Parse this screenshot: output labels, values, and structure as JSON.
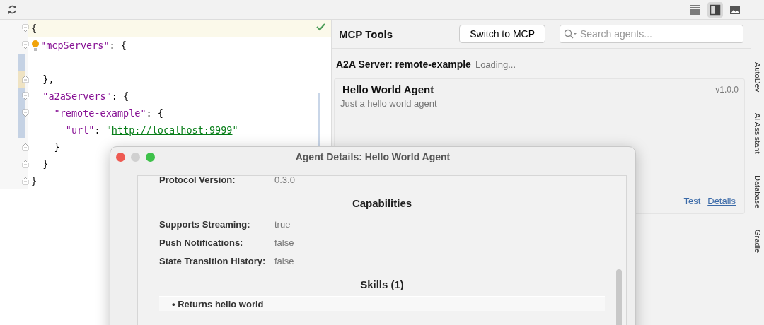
{
  "toolbar": {
    "view_buttons": [
      {
        "kind": "list",
        "selected": false
      },
      {
        "kind": "panel",
        "selected": true
      },
      {
        "kind": "image",
        "selected": false
      }
    ]
  },
  "editor": {
    "lines": [
      {
        "kind": "code",
        "current": true,
        "fold_start": true,
        "fold_end": false,
        "hint": false,
        "changed": false,
        "added": false,
        "tokens": [
          {
            "kind": "punct",
            "text": "{"
          }
        ]
      },
      {
        "kind": "code",
        "current": false,
        "fold_start": true,
        "fold_end": false,
        "hint": true,
        "changed": false,
        "added": false,
        "tokens": [
          {
            "kind": "key",
            "text": "\"mcpServers\""
          },
          {
            "kind": "punct",
            "text": ": {"
          }
        ]
      },
      {
        "kind": "blank",
        "current": false,
        "fold_start": false,
        "fold_end": false,
        "hint": false,
        "changed": true,
        "added": false
      },
      {
        "kind": "code",
        "current": false,
        "fold_start": false,
        "fold_end": true,
        "hint": false,
        "changed": false,
        "added": true,
        "tokens": [
          {
            "kind": "punct",
            "text": "  },"
          }
        ]
      },
      {
        "kind": "code",
        "current": false,
        "fold_start": true,
        "fold_end": false,
        "hint": false,
        "changed": true,
        "added": false,
        "tokens": [
          {
            "kind": "key",
            "text": "  \"a2aServers\""
          },
          {
            "kind": "punct",
            "text": ": {"
          }
        ]
      },
      {
        "kind": "code",
        "current": false,
        "fold_start": true,
        "fold_end": false,
        "hint": false,
        "changed": true,
        "added": false,
        "tokens": [
          {
            "kind": "key",
            "text": "    \"remote-example\""
          },
          {
            "kind": "punct",
            "text": ": {"
          }
        ]
      },
      {
        "kind": "code",
        "current": false,
        "fold_start": false,
        "fold_end": false,
        "hint": false,
        "changed": true,
        "added": false,
        "tokens": [
          {
            "kind": "key",
            "text": "      \"url\""
          },
          {
            "kind": "punct",
            "text": ": "
          },
          {
            "kind": "string",
            "text": "\""
          },
          {
            "kind": "link",
            "text": "http://localhost:9999"
          },
          {
            "kind": "string",
            "text": "\""
          }
        ]
      },
      {
        "kind": "code",
        "current": false,
        "fold_start": false,
        "fold_end": true,
        "hint": false,
        "changed": false,
        "added": false,
        "tokens": [
          {
            "kind": "punct",
            "text": "    }"
          }
        ]
      },
      {
        "kind": "code",
        "current": false,
        "fold_start": false,
        "fold_end": true,
        "hint": false,
        "changed": false,
        "added": false,
        "tokens": [
          {
            "kind": "punct",
            "text": "  }"
          }
        ]
      },
      {
        "kind": "code",
        "current": false,
        "fold_start": false,
        "fold_end": true,
        "hint": false,
        "changed": false,
        "added": false,
        "tokens": [
          {
            "kind": "punct",
            "text": "}"
          }
        ]
      }
    ]
  },
  "panel": {
    "title": "MCP Tools",
    "switch_button": "Switch to MCP",
    "search": {
      "placeholder": "Search agents..."
    },
    "server": {
      "name": "A2A Server: remote-example",
      "status": "Loading..."
    },
    "agent": {
      "name": "Hello World Agent",
      "version": "v1.0.0",
      "description": "Just a hello world agent",
      "links": [
        "Test",
        "Details"
      ]
    }
  },
  "side_tabs": [
    "AutoDev",
    "AI Assistant",
    "Database",
    "Gradle"
  ],
  "dialog": {
    "title": "Agent Details: Hello World Agent",
    "fields": [
      {
        "label": "Protocol Version:",
        "value": "0.3.0"
      }
    ],
    "sections": [
      {
        "heading": "Capabilities",
        "fields": [
          {
            "label": "Supports Streaming:",
            "value": "true"
          },
          {
            "label": "Push Notifications:",
            "value": "false"
          },
          {
            "label": "State Transition History:",
            "value": "false"
          }
        ]
      },
      {
        "heading": "Skills (1)",
        "skills": [
          "• Returns hello world"
        ]
      }
    ]
  }
}
